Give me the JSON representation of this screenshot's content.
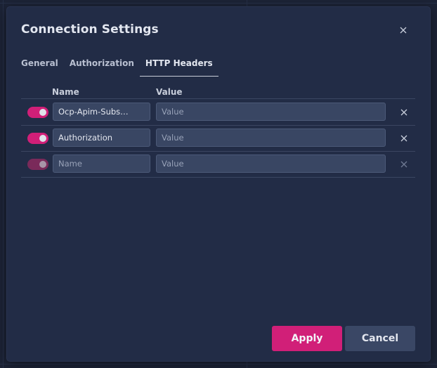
{
  "dialog": {
    "title": "Connection Settings",
    "close_icon": "close-icon"
  },
  "tabs": [
    {
      "label": "General",
      "active": false
    },
    {
      "label": "Authorization",
      "active": false
    },
    {
      "label": "HTTP Headers",
      "active": true
    }
  ],
  "headers_table": {
    "columns": {
      "name": "Name",
      "value": "Value"
    },
    "rows": [
      {
        "enabled": true,
        "name": "Ocp-Apim-Subs…",
        "name_placeholder": "Name",
        "value": "",
        "value_placeholder": "Value",
        "delete_icon": "close-icon"
      },
      {
        "enabled": true,
        "name": "Authorization",
        "name_placeholder": "Name",
        "value": "",
        "value_placeholder": "Value",
        "delete_icon": "close-icon"
      },
      {
        "enabled": false,
        "name": "",
        "name_placeholder": "Name",
        "value": "",
        "value_placeholder": "Value",
        "delete_icon": "close-icon"
      }
    ]
  },
  "footer": {
    "apply_label": "Apply",
    "cancel_label": "Cancel"
  },
  "colors": {
    "accent": "#d11f78",
    "dialog_bg": "#222c46",
    "input_bg": "#394663",
    "secondary_button": "#3a4765"
  }
}
